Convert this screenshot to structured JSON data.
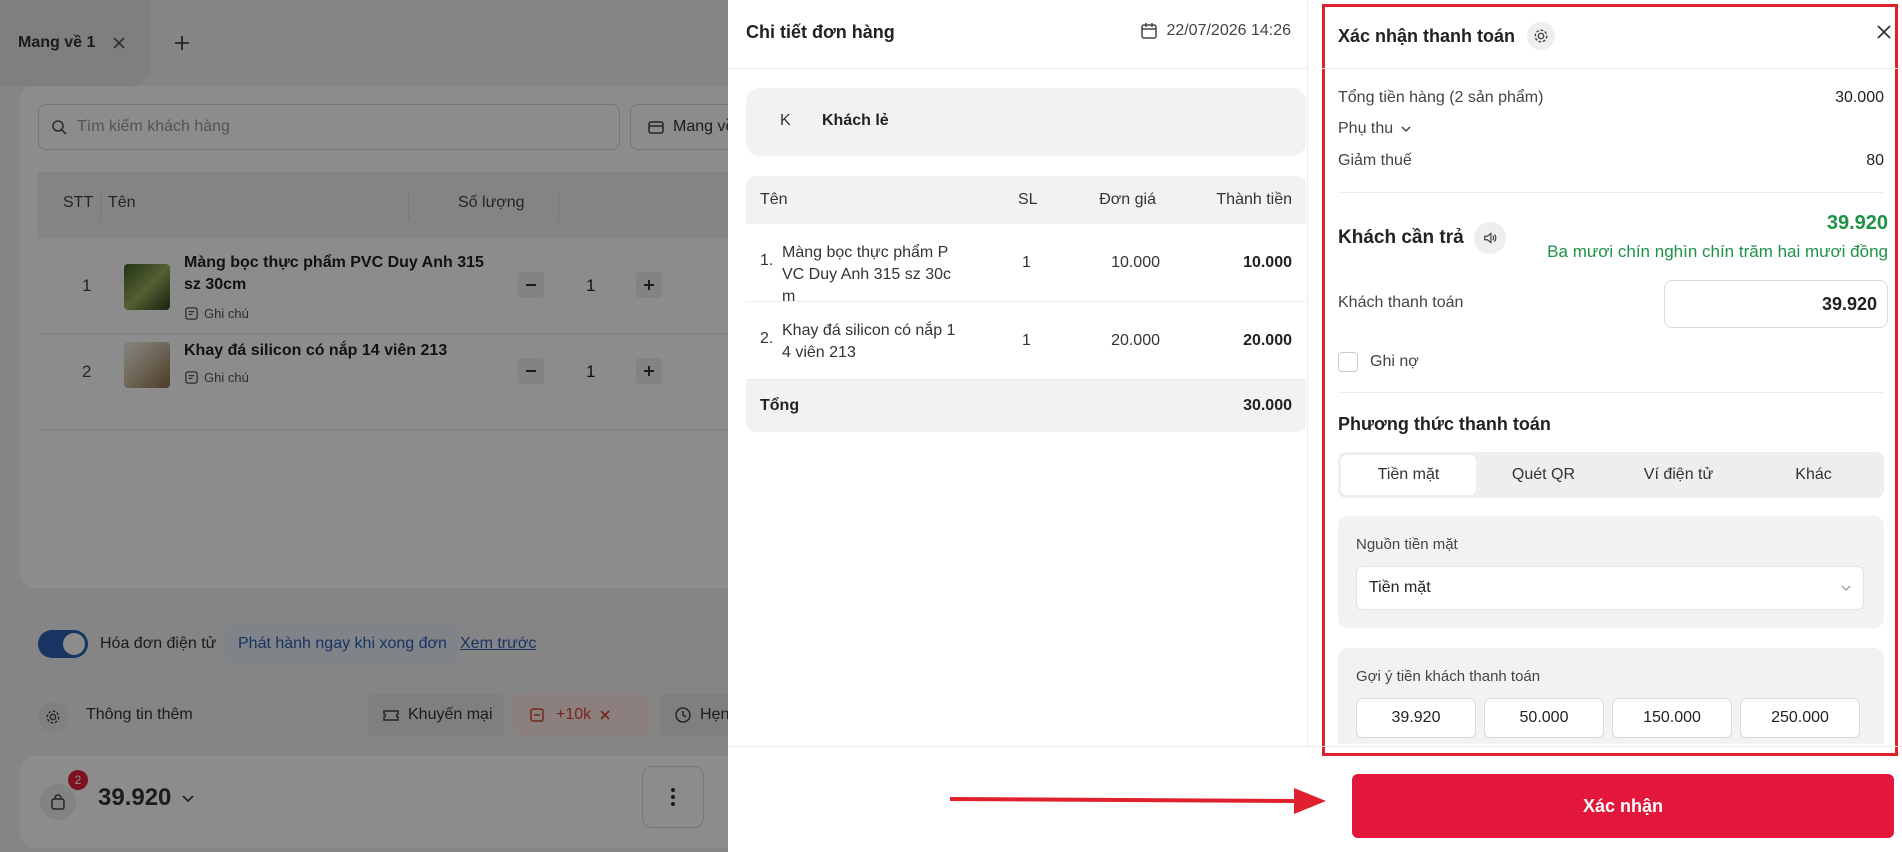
{
  "tab": {
    "label": "Mang về 1"
  },
  "cart": {
    "search_placeholder": "Tìm kiếm khách hàng",
    "order_type": "Mang về",
    "headers": {
      "stt": "STT",
      "name": "Tên",
      "qty": "Số lượng"
    },
    "rows": [
      {
        "stt": "1",
        "name": "Màng bọc thực phẩm PVC Duy Anh 315 sz 30cm",
        "note": "Ghi chú",
        "qty": "1"
      },
      {
        "stt": "2",
        "name": "Khay đá silicon có nắp 14 viên 213",
        "note": "Ghi chú",
        "qty": "1"
      }
    ]
  },
  "footer": {
    "einvoice_label": "Hóa đơn điện tử",
    "publish_label": "Phát hành ngay khi xong đơn",
    "preview_label": "Xem trước",
    "more_info_label": "Thông tin thêm",
    "promo_label": "Khuyến mại",
    "surcharge_label": "+10k",
    "schedule_label": "Hẹn",
    "bag_count": "2",
    "total": "39.920"
  },
  "detail": {
    "title": "Chi tiết đơn hàng",
    "date": "22/07/2026 14:26",
    "customer_initial": "K",
    "customer_name": "Khách lẻ",
    "headers": {
      "name": "Tên",
      "sl": "SL",
      "price": "Đơn giá",
      "total": "Thành tiền"
    },
    "rows": [
      {
        "idx": "1.",
        "name": "Màng bọc thực phẩm PVC Duy Anh 315 sz 30cm",
        "sl": "1",
        "price": "10.000",
        "total": "10.000"
      },
      {
        "idx": "2.",
        "name": "Khay đá silicon có nắp 14 viên 213",
        "sl": "1",
        "price": "20.000",
        "total": "20.000"
      }
    ],
    "sum_label": "Tổng",
    "sum_value": "30.000"
  },
  "payment": {
    "title": "Xác nhận thanh toán",
    "subtotal_label": "Tổng tiền hàng (2 sản phẩm)",
    "subtotal_value": "30.000",
    "surcharge_label": "Phụ thu",
    "tax_label": "Giảm thuế",
    "tax_value": "80",
    "due_label": "Khách cần trả",
    "due_value": "39.920",
    "due_words": "Ba mươi chín nghìn chín trăm hai mươi đồng",
    "paid_label": "Khách thanh toán",
    "paid_value": "39.920",
    "debt_label": "Ghi nợ",
    "method_label": "Phương thức thanh toán",
    "methods": [
      "Tiền mặt",
      "Quét QR",
      "Ví điện tử",
      "Khác"
    ],
    "cash_source_label": "Nguồn tiền mặt",
    "cash_source_value": "Tiền mặt",
    "suggest_label": "Gợi ý tiền khách thanh toán",
    "suggestions": [
      "39.920",
      "50.000",
      "150.000",
      "250.000"
    ],
    "confirm_label": "Xác nhận",
    "accent_color": "#e3163b",
    "due_color": "#1e9246"
  }
}
